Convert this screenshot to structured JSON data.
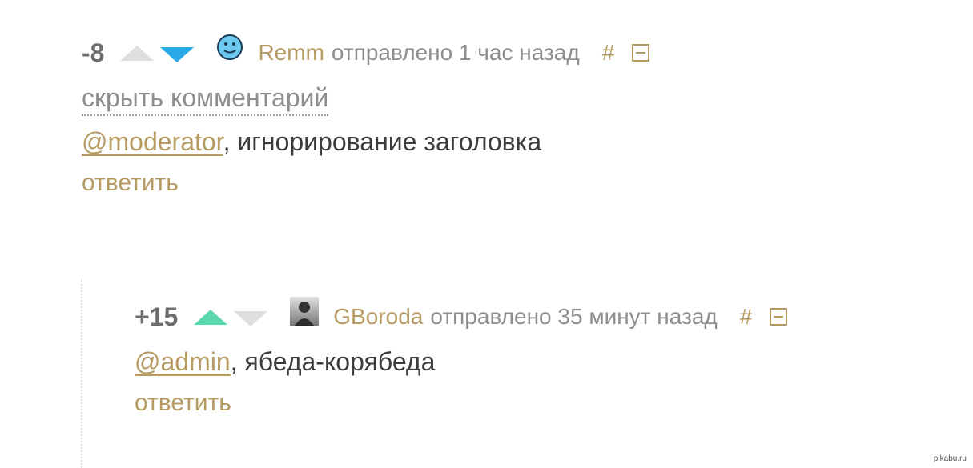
{
  "comments": [
    {
      "rating": "-8",
      "author": "Remm",
      "sent": "отправлено 1 час назад",
      "hash": "#",
      "hide_label": "скрыть комментарий",
      "mention": "@moderator",
      "text": ", игнорирование заголовка",
      "reply_label": "ответить",
      "avatar_icon": "smiley-face-icon"
    },
    {
      "rating": "+15",
      "author": "GBoroda",
      "sent": "отправлено 35 минут назад",
      "hash": "#",
      "mention": "@admin",
      "text": ", ябеда-корябеда",
      "reply_label": "ответить",
      "avatar_icon": "user-photo-icon"
    }
  ],
  "colors": {
    "link": "#b59a62",
    "upvote_active": "#5cd6ad",
    "downvote_active": "#2aa8e8",
    "vote_inactive": "#dedede"
  },
  "watermark": "pikabu.ru"
}
